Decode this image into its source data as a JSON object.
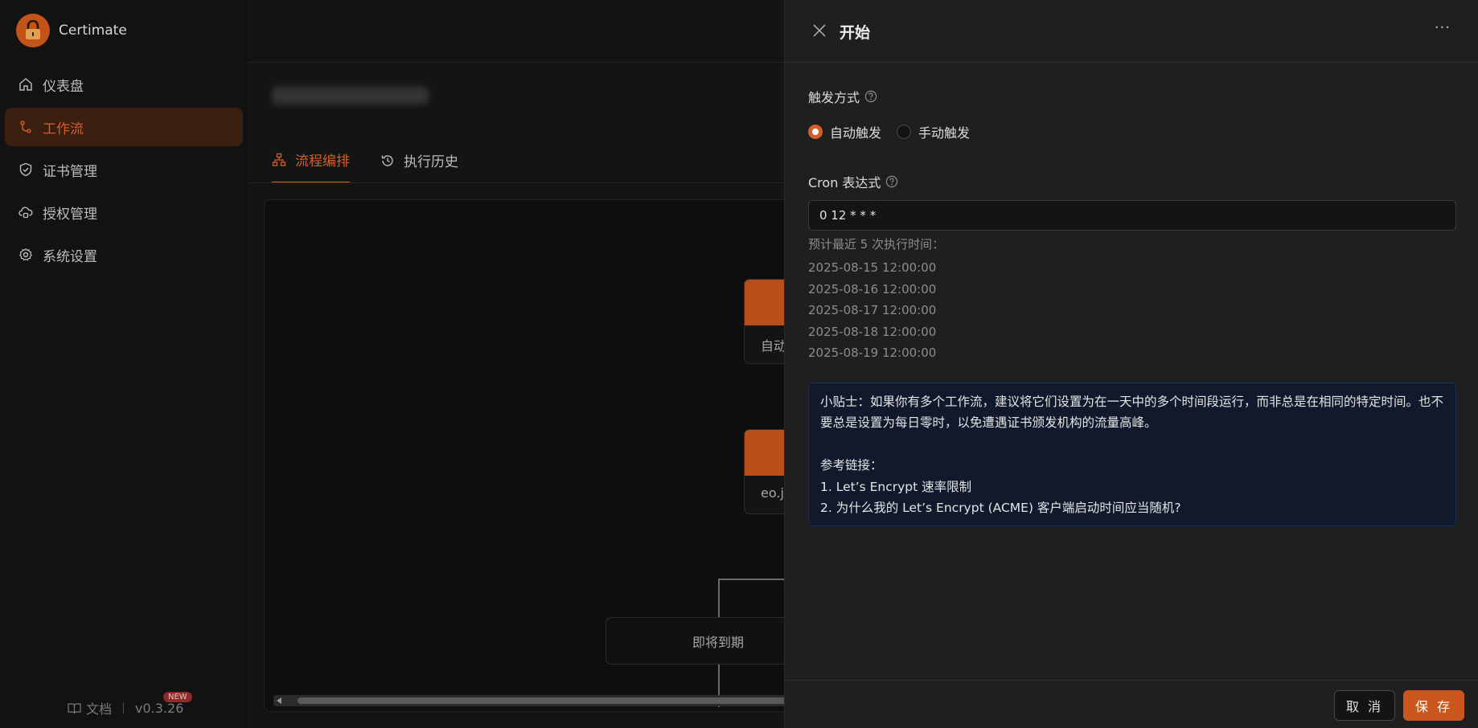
{
  "app": {
    "name": "Certimate",
    "version": "v0.3.26",
    "new_badge": "NEW",
    "docs_label": "文档"
  },
  "sidebar": {
    "items": [
      {
        "label": "仪表盘",
        "icon": "home-icon",
        "active": false
      },
      {
        "label": "工作流",
        "icon": "workflow-icon",
        "active": true
      },
      {
        "label": "证书管理",
        "icon": "shield-icon",
        "active": false
      },
      {
        "label": "授权管理",
        "icon": "cloud-lock-icon",
        "active": false
      },
      {
        "label": "系统设置",
        "icon": "gear-icon",
        "active": false
      }
    ]
  },
  "main": {
    "tabs": [
      {
        "label": "流程编排",
        "icon": "flow-icon",
        "active": true
      },
      {
        "label": "执行历史",
        "icon": "history-icon",
        "active": false
      }
    ],
    "canvas": {
      "node_start_label": "自动",
      "node_apply_label": "eo.js",
      "condition_label": "即将到期"
    }
  },
  "drawer": {
    "title": "开始",
    "more": "···",
    "trigger_label": "触发方式",
    "trigger_options": [
      {
        "label": "自动触发",
        "checked": true
      },
      {
        "label": "手动触发",
        "checked": false
      }
    ],
    "cron_label": "Cron 表达式",
    "cron_value": "0 12 * * *",
    "preview_title": "预计最近 5 次执行时间：",
    "preview_times": [
      "2025-08-15 12:00:00",
      "2025-08-16 12:00:00",
      "2025-08-17 12:00:00",
      "2025-08-18 12:00:00",
      "2025-08-19 12:00:00"
    ],
    "tip": {
      "text": "小贴士：如果你有多个工作流，建议将它们设置为在一天中的多个时间段运行，而非总是在相同的特定时间。也不要总是设置为每日零时，以免遭遇证书颁发机构的流量高峰。",
      "ref_title": "参考链接：",
      "links": [
        "1. Let’s Encrypt 速率限制",
        "2. 为什么我的 Let’s Encrypt (ACME) 客户端启动时间应当随机?"
      ]
    },
    "cancel_label": "取 消",
    "save_label": "保 存"
  },
  "colors": {
    "accent": "#d45f2a",
    "save_button": "#c9561c",
    "tip_bg": "#111a2c",
    "tip_border": "#15325b"
  }
}
